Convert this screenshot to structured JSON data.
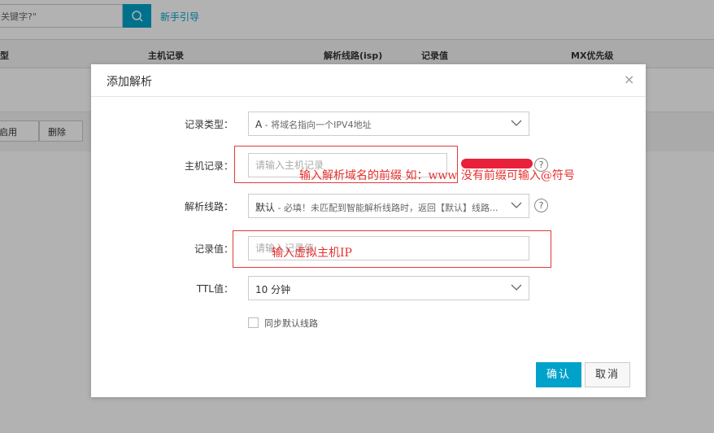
{
  "background": {
    "search_value": "关键字?\"",
    "guide_link": "新手引导",
    "table_headers": [
      "型",
      "主机记录",
      "解析线路(isp)",
      "记录值",
      "MX优先级"
    ],
    "actions": [
      "启用",
      "删除"
    ]
  },
  "modal": {
    "title": "添加解析",
    "close": "×",
    "fields": {
      "record_type": {
        "label": "记录类型：",
        "value": "A",
        "hint": " - 将域名指向一个IPV4地址"
      },
      "host": {
        "label": "主机记录：",
        "placeholder": "请输入主机记录"
      },
      "line": {
        "label": "解析线路：",
        "value": "默认",
        "hint": " - 必填！未匹配到智能解析线路时，返回【默认】线路..."
      },
      "value": {
        "label": "记录值：",
        "placeholder": "请输入记录值"
      },
      "ttl": {
        "label": "TTL值：",
        "value": "10 分钟"
      }
    },
    "sync_label": "同步默认线路",
    "confirm": "确认",
    "cancel": "取消",
    "help_icon": "?"
  },
  "annotations": {
    "host_note": "输入解析域名的前缀 如：www  没有前缀可输入@符号",
    "value_note": "输入虚拟主机IP"
  },
  "colors": {
    "accent": "#00a2ca",
    "annotation": "#e5302c"
  }
}
